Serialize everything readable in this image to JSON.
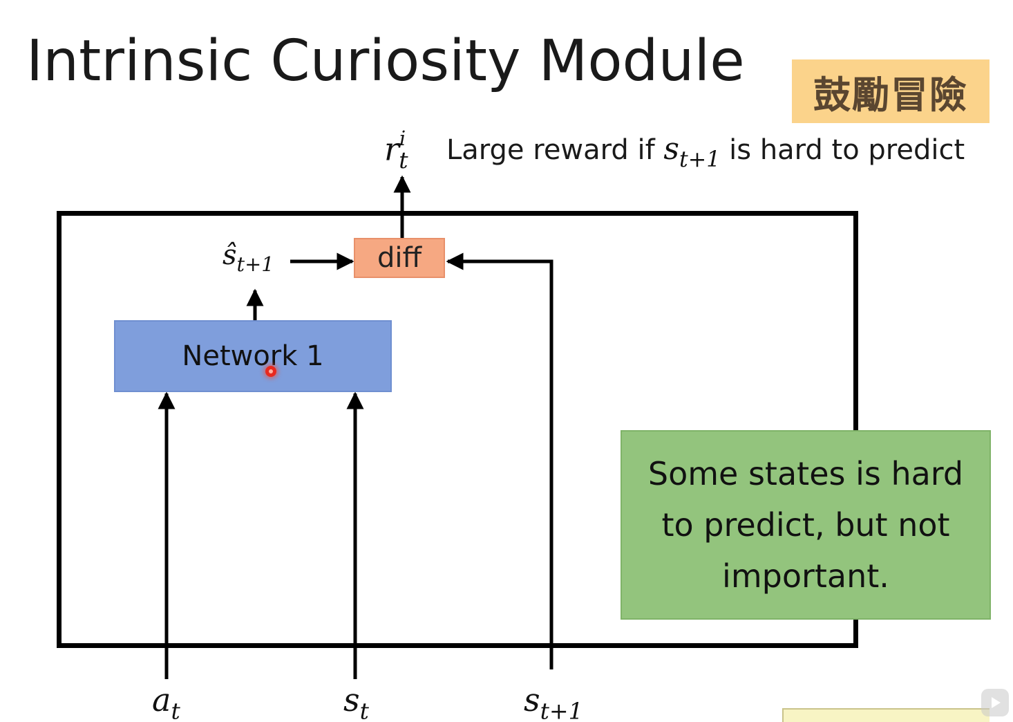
{
  "slide": {
    "title": "Intrinsic Curiosity Module",
    "badge": "鼓勵冒險",
    "reward": {
      "symbol_base": "r",
      "symbol_sub": "t",
      "symbol_sup": "i",
      "text_before": "Large reward if ",
      "state_base": "s",
      "state_sub": "t+1",
      "text_after": " is hard to predict"
    },
    "diff_label": "diff",
    "network_label": "Network 1",
    "predicted_state": {
      "base": "ŝ",
      "sub": "t+1"
    },
    "inputs": {
      "action": {
        "base": "a",
        "sub": "t"
      },
      "state": {
        "base": "s",
        "sub": "t"
      },
      "next_state": {
        "base": "s",
        "sub": "t+1"
      }
    },
    "note": "Some states is hard to predict, but not important.",
    "colors": {
      "badge": "#fbd38b",
      "diff_box": "#f6a882",
      "network_box": "#7f9edc",
      "note_box": "#93c47d"
    }
  }
}
